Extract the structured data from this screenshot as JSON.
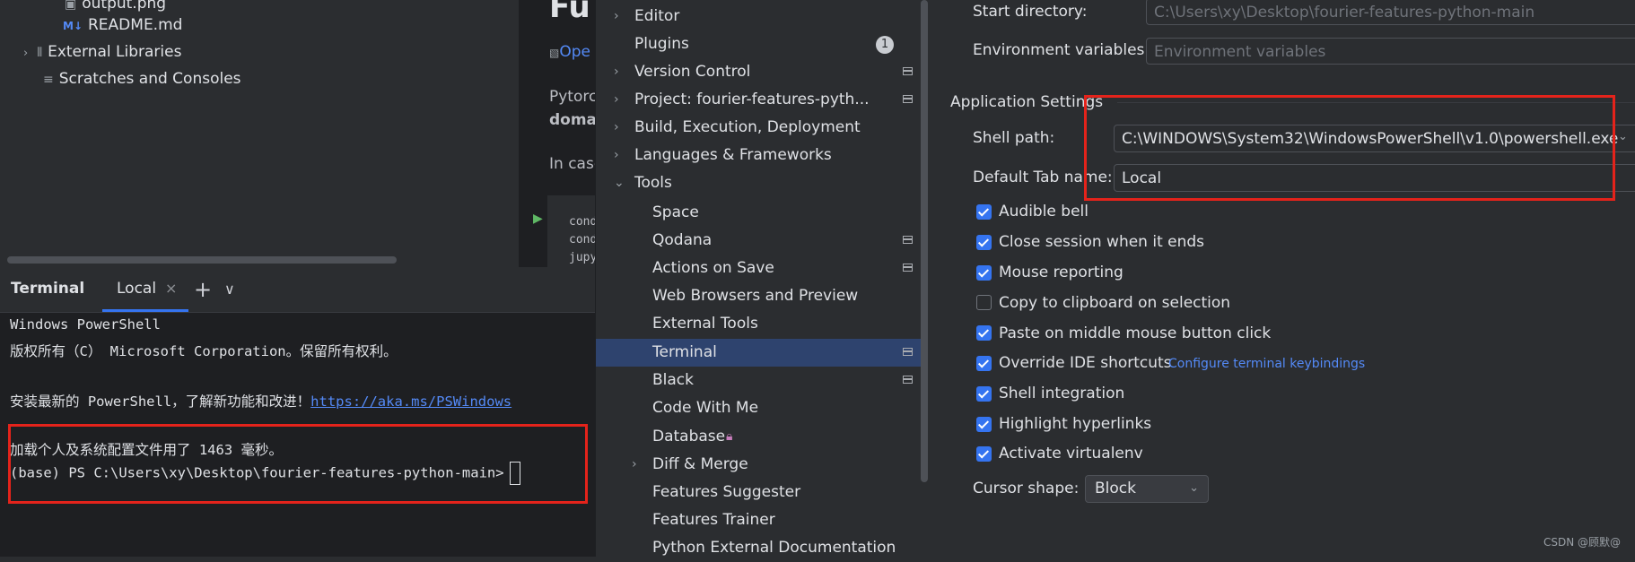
{
  "project_tree": {
    "items": [
      {
        "label": "output.png",
        "icon": "image-file-icon"
      },
      {
        "label": "README.md",
        "icon": "markdown-icon"
      },
      {
        "label": "External Libraries",
        "icon": "library-icon"
      },
      {
        "label": "Scratches and Consoles",
        "icon": "scratches-icon"
      }
    ]
  },
  "editor_peek": {
    "heading": "Fu",
    "badge_alt": "Ope",
    "text1": "Pytorc",
    "text2": "domai",
    "text3": "In case",
    "code": [
      "cond",
      "cond",
      "jupy"
    ]
  },
  "terminal": {
    "title": "Terminal",
    "tab_label": "Local",
    "tab_close": "×",
    "add_icon": "+",
    "more_icon": "⌄",
    "lines": {
      "l1": "Windows PowerShell",
      "l2": "版权所有（C） Microsoft Corporation。保留所有权利。",
      "l3_prefix": "安装最新的 PowerShell，了解新功能和改进！",
      "l3_link": "https://aka.ms/PSWindows",
      "l4": "加载个人及系统配置文件用了 1463 毫秒。",
      "l5": "(base) PS C:\\Users\\xy\\Desktop\\fourier-features-python-main>"
    }
  },
  "settings_nav": {
    "editor": "Editor",
    "plugins": "Plugins",
    "plugins_badge": "1",
    "version_control": "Version Control",
    "project": "Project: fourier-features-pyth...",
    "build": "Build, Execution, Deployment",
    "languages": "Languages & Frameworks",
    "tools": "Tools",
    "space": "Space",
    "qodana": "Qodana",
    "actions_on_save": "Actions on Save",
    "web_browsers": "Web Browsers and Preview",
    "external_tools": "External Tools",
    "terminal": "Terminal",
    "black": "Black",
    "code_with_me": "Code With Me",
    "database": "Database",
    "diff_merge": "Diff & Merge",
    "features_suggester": "Features Suggester",
    "features_trainer": "Features Trainer",
    "python_ext_docs": "Python External Documentation"
  },
  "settings_content": {
    "start_dir_label": "Start directory:",
    "start_dir_value": "C:\\Users\\xy\\Desktop\\fourier-features-python-main",
    "env_label": "Environment variables:",
    "env_placeholder": "Environment variables",
    "app_settings_title": "Application Settings",
    "shell_path_label": "Shell path:",
    "shell_path_value": "C:\\WINDOWS\\System32\\WindowsPowerShell\\v1.0\\powershell.exe",
    "tab_name_label": "Default Tab name:",
    "tab_name_value": "Local",
    "checkboxes": [
      {
        "label": "Audible bell",
        "checked": true
      },
      {
        "label": "Close session when it ends",
        "checked": true
      },
      {
        "label": "Mouse reporting",
        "checked": true
      },
      {
        "label": "Copy to clipboard on selection",
        "checked": false
      },
      {
        "label": "Paste on middle mouse button click",
        "checked": true
      },
      {
        "label": "Override IDE shortcuts",
        "checked": true
      },
      {
        "label": "Shell integration",
        "checked": true
      },
      {
        "label": "Highlight hyperlinks",
        "checked": true
      },
      {
        "label": "Activate virtualenv",
        "checked": true
      }
    ],
    "configure_link": "Configure terminal keybindings",
    "cursor_shape_label": "Cursor shape:",
    "cursor_shape_value": "Block"
  },
  "watermark": "CSDN @顾默@",
  "colors": {
    "accent": "#3574f0",
    "highlight_box": "#e4231b",
    "selection": "#2e436e"
  }
}
